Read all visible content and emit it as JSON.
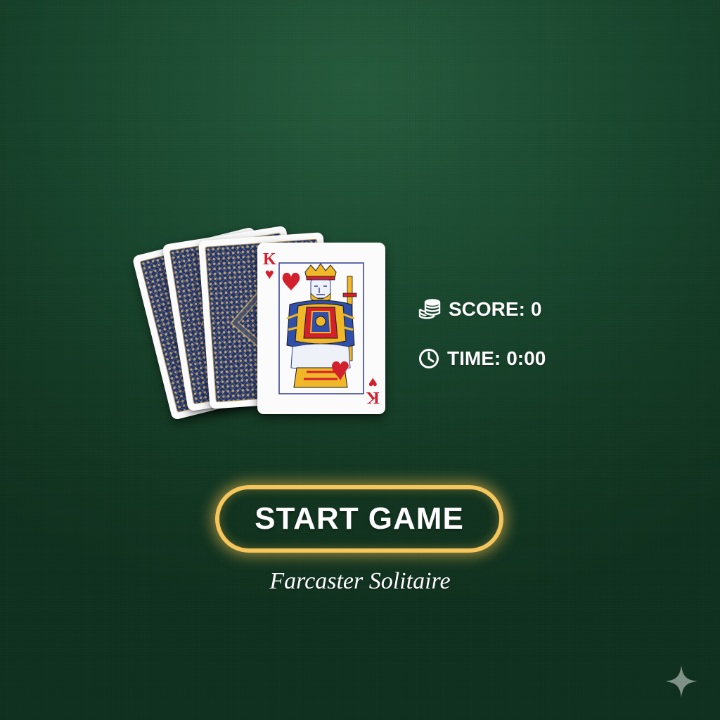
{
  "hand": {
    "face_card": {
      "rank": "K",
      "suit": "♥",
      "suit_name": "hearts"
    },
    "back_cards": 3
  },
  "stats": {
    "score_label": "SCORE:",
    "score_value": "0",
    "time_label": "TIME:",
    "time_value": "0:00"
  },
  "start_button": {
    "label": "START GAME"
  },
  "app_title": "Farcaster Solitaire",
  "colors": {
    "felt": "#1a4a30",
    "button_glow": "#f5c65b",
    "card_back": "#22356f",
    "heart_red": "#d3202d"
  },
  "icons": [
    "coin-stack-icon",
    "clock-icon",
    "sparkle-icon"
  ]
}
